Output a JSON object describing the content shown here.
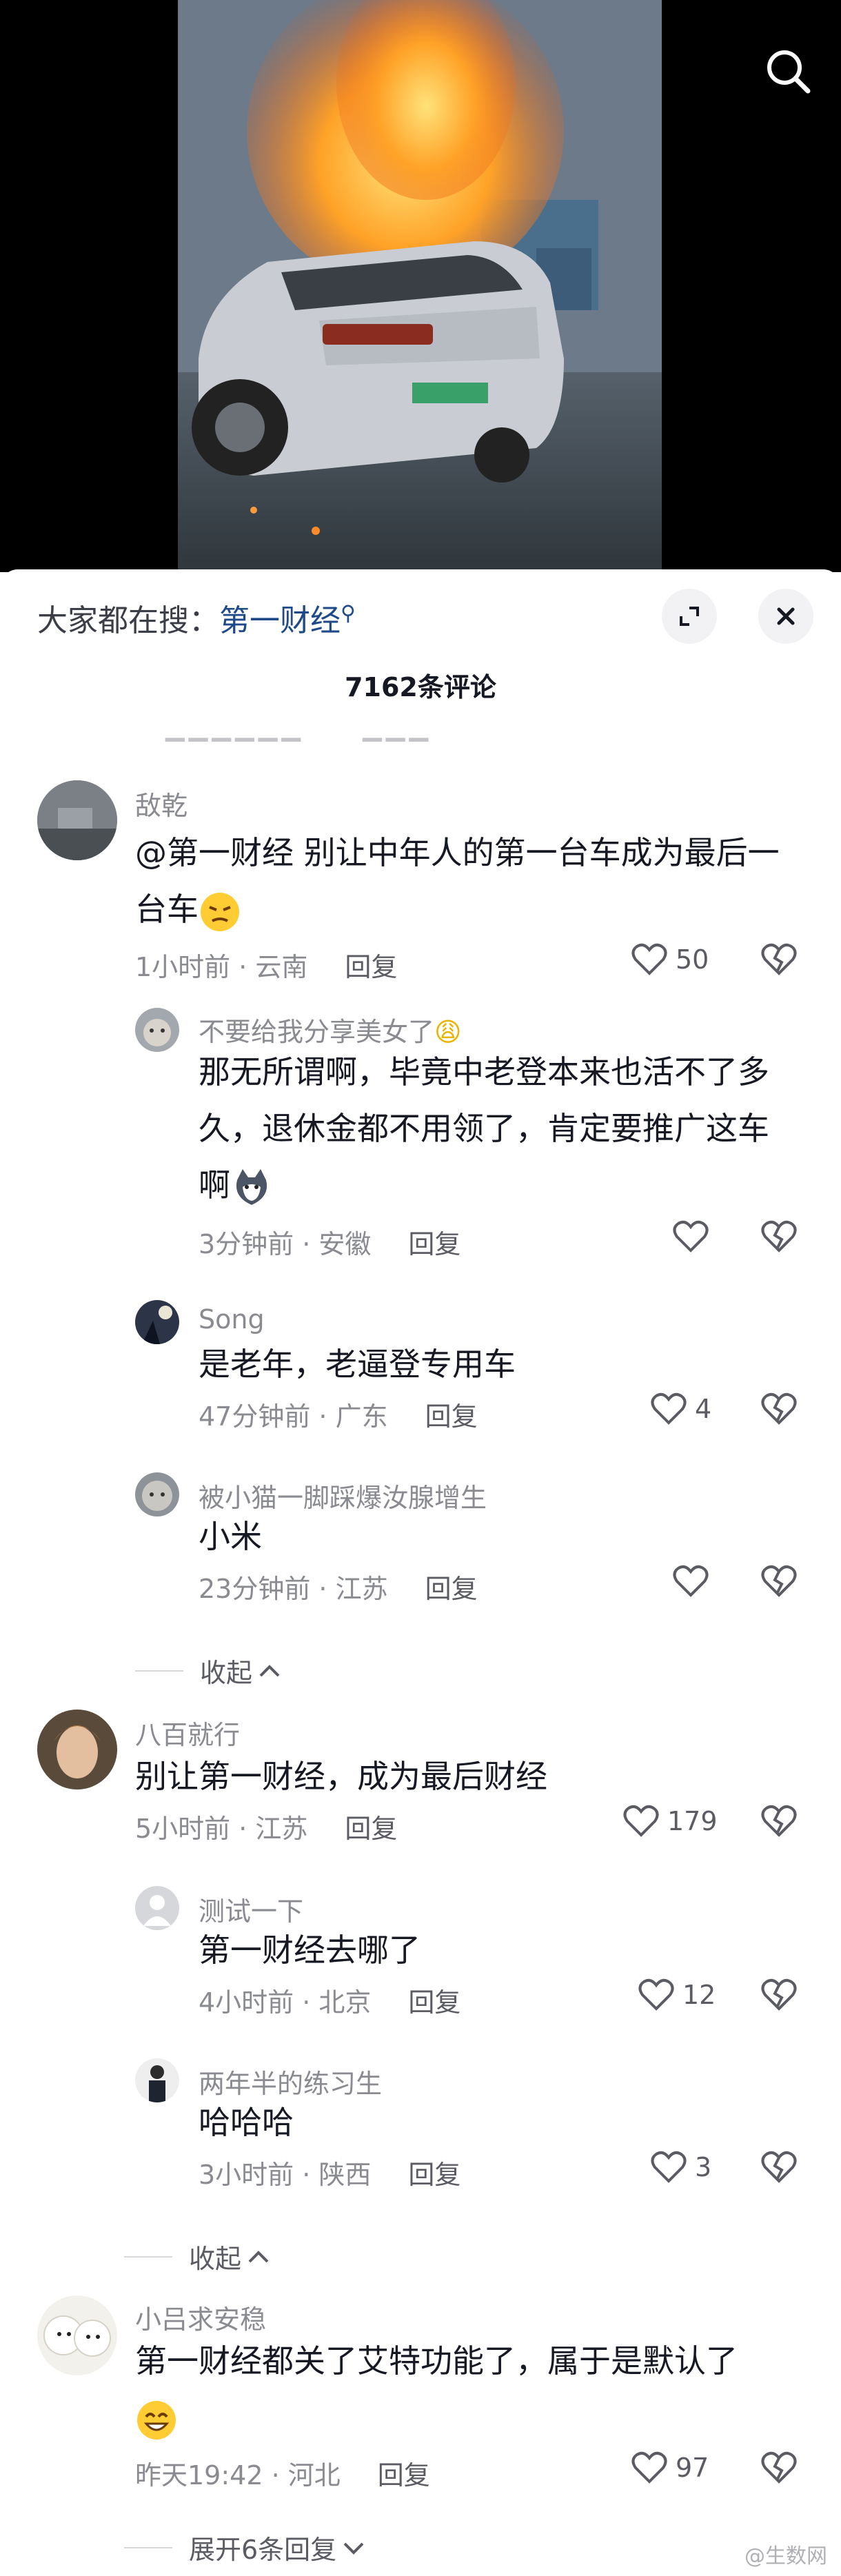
{
  "top": {
    "search_icon": "search-icon"
  },
  "sheet": {
    "search_prefix": "大家都在搜：",
    "search_term": "第一财经",
    "expand_icon": "expand-icon",
    "close_icon": "close-icon",
    "comment_count": "7162条评论"
  },
  "comments": [
    {
      "user": "敌乾",
      "text1": "@第一财经 别让中年人的第一台车成为最后一",
      "text2": "台车",
      "time": "1小时前 · 云南",
      "reply": "回复",
      "likes": "50",
      "replies": [
        {
          "user": "不要给我分享美女了",
          "text1": "那无所谓啊，毕竟中老登本来也活不了多",
          "text2": "久，退休金都不用领了，肯定要推广这车",
          "text3": "啊",
          "time": "3分钟前 · 安徽",
          "reply": "回复",
          "likes": ""
        },
        {
          "user": "Song",
          "text1": "是老年，老逼登专用车",
          "time": "47分钟前 · 广东",
          "reply": "回复",
          "likes": "4"
        },
        {
          "user": "被小猫一脚踩爆汝腺增生",
          "text1": "小米",
          "time": "23分钟前 · 江苏",
          "reply": "回复",
          "likes": ""
        }
      ],
      "collapse": "收起"
    },
    {
      "user": "八百就行",
      "text1": "别让第一财经，成为最后财经",
      "time": "5小时前 · 江苏",
      "reply": "回复",
      "likes": "179",
      "replies": [
        {
          "user": "测试一下",
          "text1": "第一财经去哪了",
          "time": "4小时前 · 北京",
          "reply": "回复",
          "likes": "12"
        },
        {
          "user": "两年半的练习生",
          "text1": "哈哈哈",
          "time": "3小时前 · 陕西",
          "reply": "回复",
          "likes": "3"
        }
      ],
      "collapse": "收起"
    },
    {
      "user": "小吕求安稳",
      "text1": "第一财经都关了艾特功能了，属于是默认了",
      "time": "昨天19:42 · 河北",
      "reply": "回复",
      "likes": "97",
      "expand": "展开6条回复"
    }
  ],
  "watermark": "@生数网"
}
